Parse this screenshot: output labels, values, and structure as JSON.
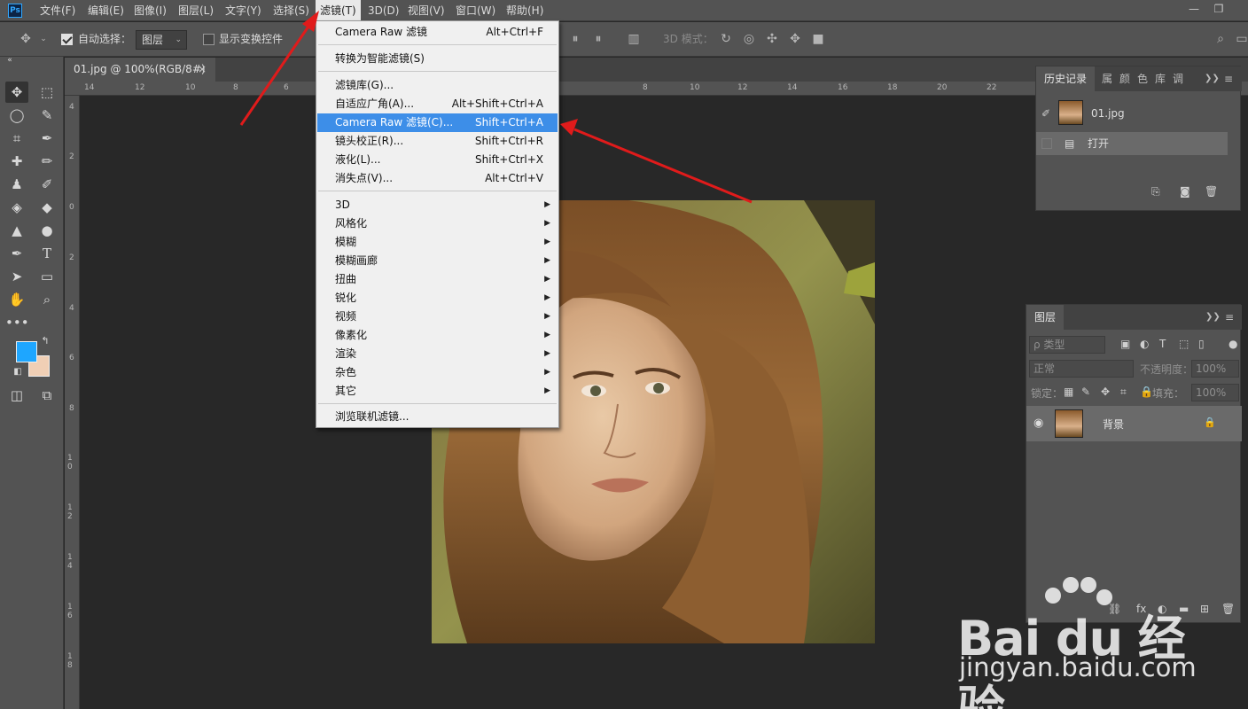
{
  "app": {
    "logo": "Ps"
  },
  "menubar": {
    "items": [
      "文件(F)",
      "编辑(E)",
      "图像(I)",
      "图层(L)",
      "文字(Y)",
      "选择(S)",
      "滤镜(T)",
      "3D(D)",
      "视图(V)",
      "窗口(W)",
      "帮助(H)"
    ],
    "active_index": 6
  },
  "options": {
    "auto_select_label": "自动选择：",
    "auto_select_checked": true,
    "auto_select_target": "图层",
    "show_transform_label": "显示变换控件",
    "show_transform_checked": false,
    "mode_3d_label": "3D 模式："
  },
  "document": {
    "tab_title": "01.jpg @ 100%(RGB/8#)",
    "tab_close": "×",
    "ruler_h": [
      "14",
      "12",
      "10",
      "8",
      "6",
      "8",
      "10",
      "12",
      "14",
      "16",
      "18",
      "20",
      "22"
    ],
    "ruler_v": [
      "4",
      "2",
      "0",
      "2",
      "4",
      "6",
      "8",
      "1 0",
      "1 2",
      "1 4",
      "1 6",
      "1 8"
    ]
  },
  "colors": {
    "foreground": "#1ea6ff",
    "background": "#f0cfb5",
    "menu_highlight": "#3d8ee8",
    "arrow": "#e01b1b"
  },
  "filter_menu": {
    "groups": [
      [
        {
          "label": "Camera Raw 滤镜",
          "shortcut": "Alt+Ctrl+F"
        }
      ],
      [
        {
          "label": "转换为智能滤镜(S)",
          "shortcut": ""
        }
      ],
      [
        {
          "label": "滤镜库(G)...",
          "shortcut": ""
        },
        {
          "label": "自适应广角(A)...",
          "shortcut": "Alt+Shift+Ctrl+A"
        },
        {
          "label": "Camera Raw 滤镜(C)...",
          "shortcut": "Shift+Ctrl+A",
          "highlighted": true
        },
        {
          "label": "镜头校正(R)...",
          "shortcut": "Shift+Ctrl+R"
        },
        {
          "label": "液化(L)...",
          "shortcut": "Shift+Ctrl+X"
        },
        {
          "label": "消失点(V)...",
          "shortcut": "Alt+Ctrl+V"
        }
      ],
      [
        {
          "label": "3D",
          "submenu": true
        },
        {
          "label": "风格化",
          "submenu": true
        },
        {
          "label": "模糊",
          "submenu": true
        },
        {
          "label": "模糊画廊",
          "submenu": true
        },
        {
          "label": "扭曲",
          "submenu": true
        },
        {
          "label": "锐化",
          "submenu": true
        },
        {
          "label": "视频",
          "submenu": true
        },
        {
          "label": "像素化",
          "submenu": true
        },
        {
          "label": "渲染",
          "submenu": true
        },
        {
          "label": "杂色",
          "submenu": true
        },
        {
          "label": "其它",
          "submenu": true
        }
      ],
      [
        {
          "label": "浏览联机滤镜...",
          "shortcut": ""
        }
      ]
    ]
  },
  "history_panel": {
    "tabs": [
      "历史记录",
      "属",
      "颜",
      "色",
      "库",
      "调"
    ],
    "snapshot": "01.jpg",
    "steps": [
      "打开"
    ]
  },
  "layers_panel": {
    "tab": "图层",
    "filter_placeholder": "ρ 类型",
    "blend_mode": "正常",
    "opacity_label": "不透明度：",
    "opacity_value": "100%",
    "lock_label": "锁定：",
    "fill_label": "填充：",
    "fill_value": "100%",
    "layers": [
      {
        "name": "背景",
        "visible": true,
        "locked": true
      }
    ]
  },
  "watermark": {
    "logo": "Bai du 经验",
    "url": "jingyan.baidu.com"
  }
}
